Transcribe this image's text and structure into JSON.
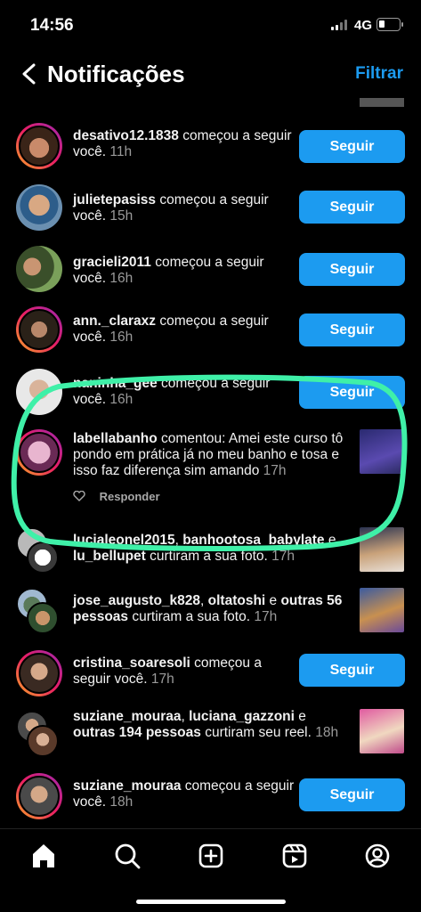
{
  "status": {
    "time": "14:56",
    "network": "4G"
  },
  "header": {
    "title": "Notificações",
    "filter_label": "Filtrar"
  },
  "notifications": [
    {
      "user": "desativo12.1838",
      "action": " começou a seguir você.",
      "time": "11h",
      "button": "Seguir"
    },
    {
      "user": "julietepasiss",
      "action": " começou a seguir você.",
      "time": "15h",
      "button": "Seguir"
    },
    {
      "user": "gracieli2011",
      "action": " começou a seguir você.",
      "time": "16h",
      "button": "Seguir"
    },
    {
      "user": "ann._claraxz",
      "action": " começou a seguir você.",
      "time": "16h",
      "button": "Seguir"
    },
    {
      "user": "naninha_gee",
      "action": " começou a seguir você.",
      "time": "16h",
      "button": "Seguir"
    },
    {
      "user": "labellabanho",
      "action": " comentou: Amei este curso tô pondo em prática já no meu banho e tosa e isso faz diferença sim amando",
      "time": "17h",
      "reply_label": "Responder"
    },
    {
      "user": "lucialeonel2015",
      "sep": ", ",
      "user2": "banhootosa_babylate",
      "sep2": " e ",
      "user3": "lu_bellupet",
      "action": " curtiram a sua foto.",
      "time": "17h"
    },
    {
      "user": "jose_augusto_k828",
      "sep": ", ",
      "user2": "oltatoshi",
      "sep2": " e ",
      "user3": "outras 56 pessoas",
      "action": " curtiram a sua foto.",
      "time": "17h"
    },
    {
      "user": "cristina_soaresoli",
      "action": " começou a seguir você.",
      "time": "17h",
      "button": "Seguir"
    },
    {
      "user": "suziane_mouraa",
      "sep": ", ",
      "user2": "luciana_gazzoni",
      "sep2": " e ",
      "user3": "outras 194 pessoas",
      "action": " curtiram seu reel.",
      "time": "18h"
    },
    {
      "user": "suziane_mouraa",
      "action": " começou a seguir você.",
      "time": "18h",
      "button": "Seguir"
    }
  ],
  "tabs": [
    "home-icon",
    "search-icon",
    "create-icon",
    "reels-icon",
    "profile-icon"
  ],
  "colors": {
    "accent": "#1c9bf0",
    "highlight": "#3ff0a8"
  }
}
